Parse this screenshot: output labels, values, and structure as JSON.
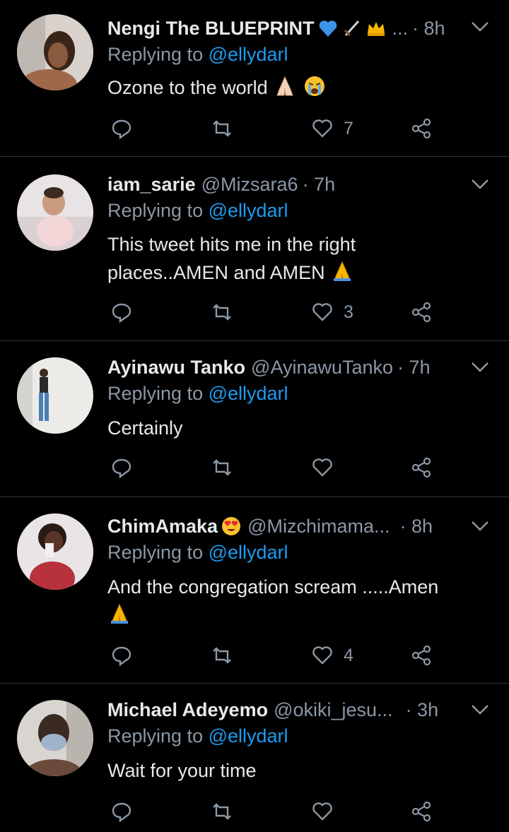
{
  "replying_prefix": "Replying to ",
  "tweets": [
    {
      "name": "Nengi The BLUEPRINT",
      "name_emojis": [
        "blue-heart-icon",
        "dagger-icon",
        "crown-icon"
      ],
      "handle": "",
      "truncation": "...",
      "time": "· 8h",
      "replying_to": "@ellydarl",
      "text": "Ozone to the world",
      "text_emojis": [
        "folded-hands-light-icon",
        "crying-face-icon"
      ],
      "likes": "7",
      "avatar_colors": [
        "#d9d2cc",
        "#8a5a3e",
        "#3a2418"
      ]
    },
    {
      "name": "iam_sarie",
      "handle": "@Mizsara6",
      "time": "· 7h",
      "replying_to": "@ellydarl",
      "text_line1": "This tweet hits me in the right",
      "text_line2": "places..AMEN and AMEN",
      "text_emojis": [
        "folded-hands-icon"
      ],
      "likes": "3",
      "avatar_colors": [
        "#e8e4e6",
        "#c99a7e",
        "#f3d6d8"
      ]
    },
    {
      "name": "Ayinawu Tanko",
      "handle": "@AyinawuTanko",
      "time": "· 7h",
      "replying_to": "@ellydarl",
      "text": "Certainly",
      "likes": "",
      "avatar_colors": [
        "#ecebe8",
        "#4b7fb4",
        "#2a2a2a"
      ]
    },
    {
      "name": "ChimAmaka",
      "name_emojis": [
        "heart-eyes-icon"
      ],
      "handle": "@Mizchimama...",
      "time": "· 8h",
      "replying_to": "@ellydarl",
      "text": "And the congregation scream .....Amen",
      "text_emojis": [
        "folded-hands-icon"
      ],
      "likes": "4",
      "avatar_colors": [
        "#e9e5e6",
        "#b8323e",
        "#5a3426"
      ]
    },
    {
      "name": "Michael Adeyemo",
      "handle": "@okiki_jesu...",
      "time": "· 3h",
      "replying_to": "@ellydarl",
      "text": "Wait for your time",
      "likes": "",
      "avatar_colors": [
        "#d8d4cf",
        "#3a2a22",
        "#9fb4c8"
      ]
    }
  ],
  "colors": {
    "background": "#000000",
    "divider": "#2f3336",
    "secondary_text": "#8b98a5",
    "mention": "#1d9bf0"
  }
}
